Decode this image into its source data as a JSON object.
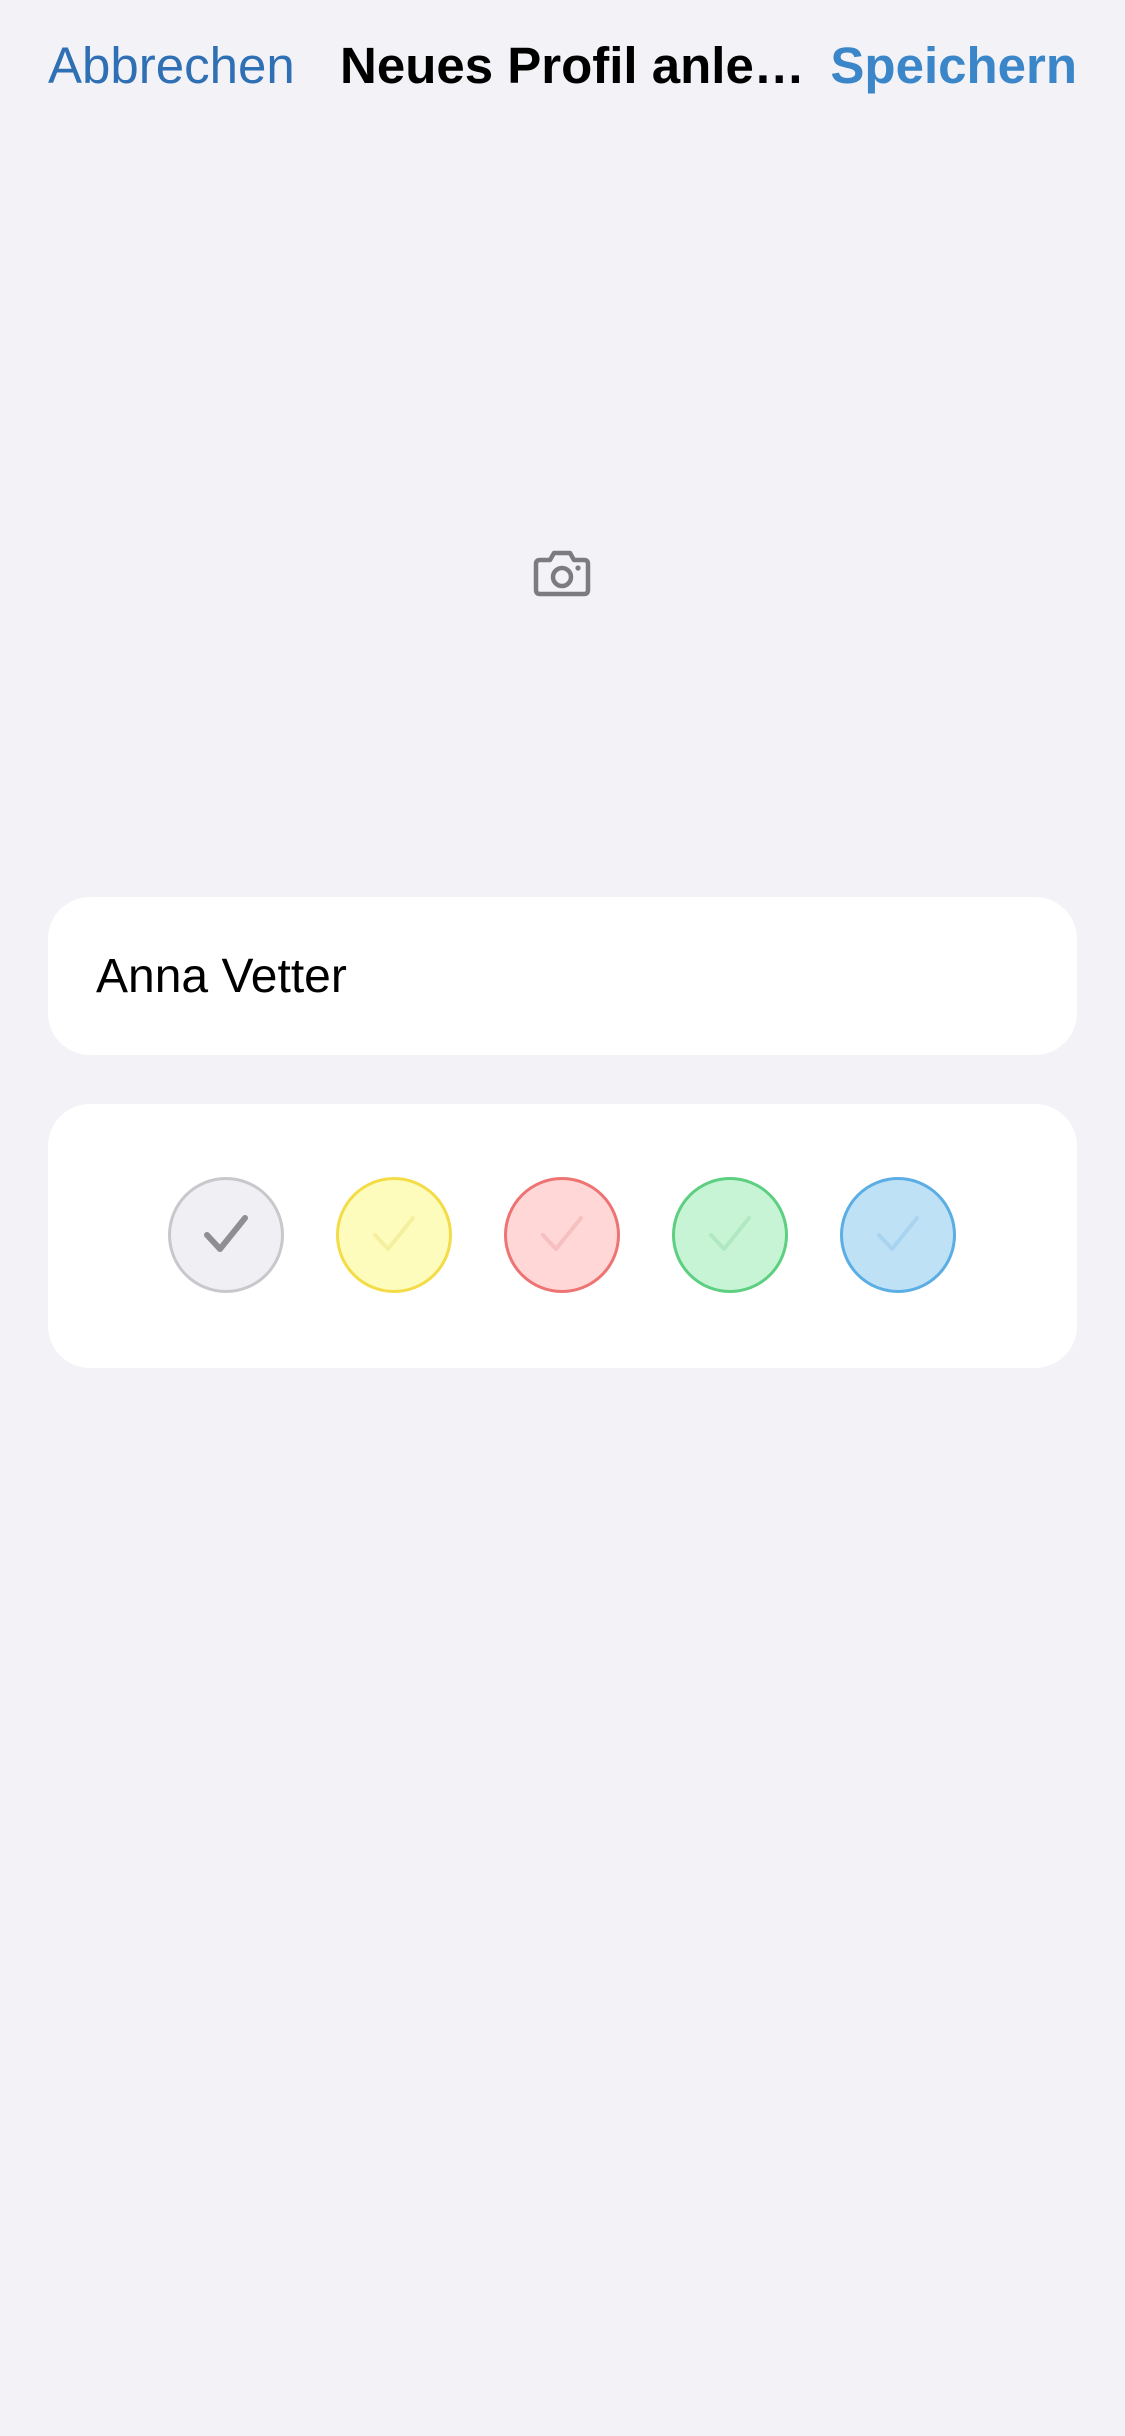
{
  "nav": {
    "cancel_label": "Abbrechen",
    "title": "Neues Profil anle…",
    "save_label": "Speichern"
  },
  "photo": {
    "icon": "camera-icon"
  },
  "name_field": {
    "value": "Anna Vetter"
  },
  "color_picker": {
    "selected": "gray",
    "swatches": [
      {
        "name": "gray",
        "fill": "#efeff4",
        "border": "#c8c8cc",
        "check": "#8e8e93"
      },
      {
        "name": "yellow",
        "fill": "#fdfcbc",
        "border": "#f3dc48",
        "check": "#f5f0a0"
      },
      {
        "name": "red",
        "fill": "#ffd7d7",
        "border": "#ee7373",
        "check": "#f7c0c0"
      },
      {
        "name": "green",
        "fill": "#c8f4d6",
        "border": "#5ccf80",
        "check": "#b0e8c2"
      },
      {
        "name": "blue",
        "fill": "#bfe1f6",
        "border": "#5aaee3",
        "check": "#a8d4f0"
      }
    ]
  },
  "colors": {
    "background": "#f2f2f7",
    "card": "#ffffff",
    "accent": "#3a86c8",
    "cancel": "#2f6fb3",
    "icon": "#7c7c80"
  }
}
